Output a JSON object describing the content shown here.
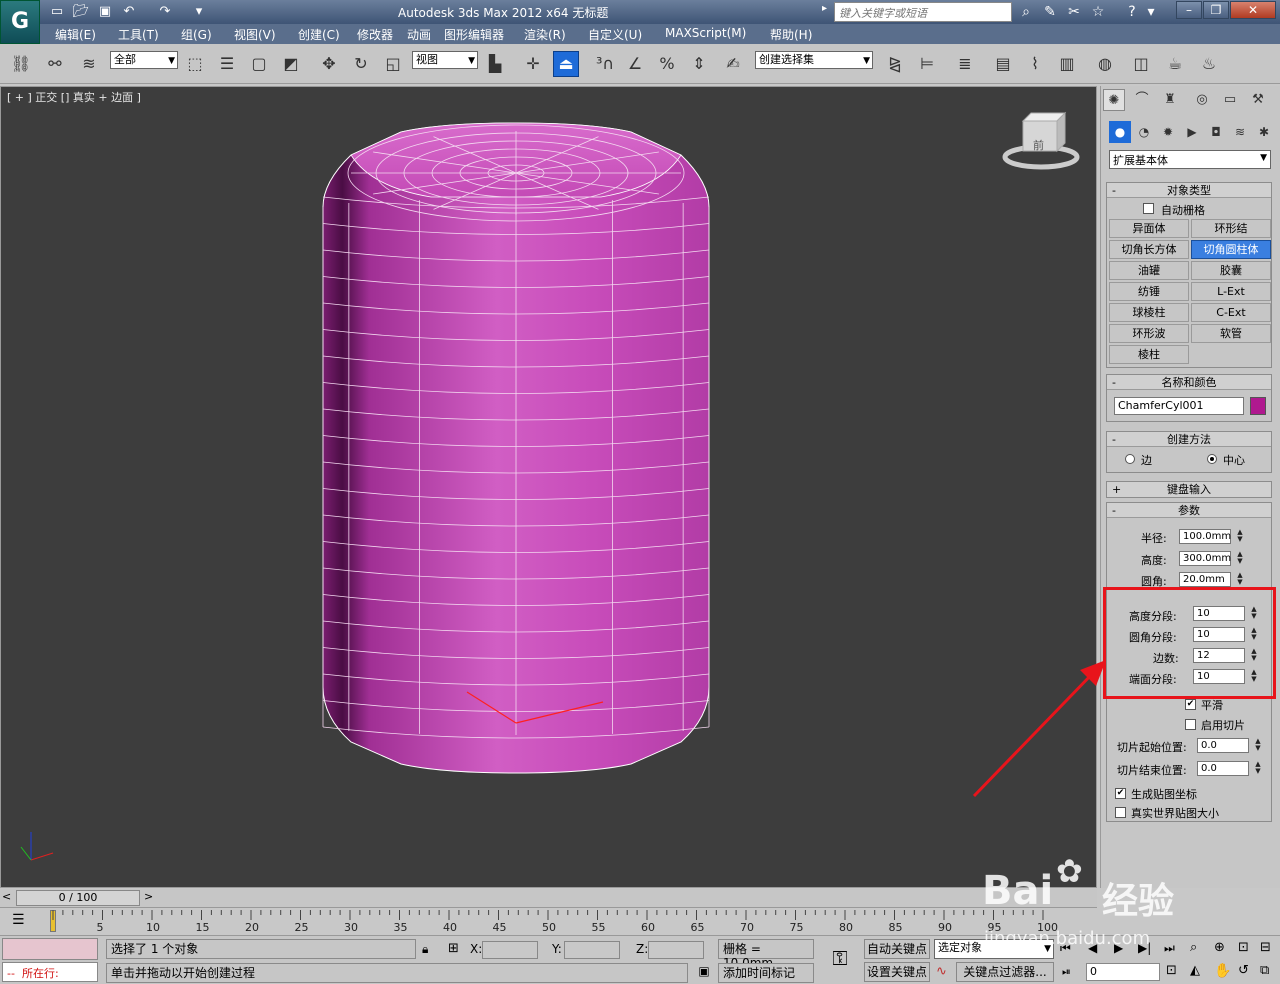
{
  "titlebar": {
    "title": "Autodesk 3ds Max  2012 x64     无标题",
    "search_placeholder": "键入关键字或短语",
    "app_logo": "G",
    "window_buttons": [
      "–",
      "❐",
      "✕"
    ]
  },
  "menu": [
    "编辑(E)",
    "工具(T)",
    "组(G)",
    "视图(V)",
    "创建(C)",
    "修改器",
    "动画",
    "图形编辑器",
    "渲染(R)",
    "自定义(U)",
    "MAXScript(M)",
    "帮助(H)"
  ],
  "toolbar": {
    "selection_filter": "全部",
    "ref_coord": "视图",
    "named_selection": "创建选择集"
  },
  "viewport": {
    "label": "[ + ] 正交 [] 真实 + 边面 ]",
    "viewcube_face": "前",
    "object_color": "#c23cb4"
  },
  "cmd_panel": {
    "category": "扩展基本体",
    "object_type": {
      "title": "对象类型",
      "autogrid_label": "自动栅格",
      "buttons": [
        "异面体",
        "环形结",
        "切角长方体",
        "切角圆柱体",
        "油罐",
        "胶囊",
        "纺锤",
        "L-Ext",
        "球棱柱",
        "C-Ext",
        "环形波",
        "软管",
        "棱柱"
      ],
      "selected": "切角圆柱体"
    },
    "name_color": {
      "title": "名称和颜色",
      "name": "ChamferCyl001",
      "swatch": "#b0198f"
    },
    "creation_method": {
      "title": "创建方法",
      "options": [
        "边",
        "中心"
      ],
      "selected": "中心"
    },
    "keyboard_entry": {
      "title": "键盘输入"
    },
    "parameters": {
      "title": "参数",
      "radius_label": "半径:",
      "radius": "100.0mm",
      "height_label": "高度:",
      "height": "300.0mm",
      "fillet_label": "圆角:",
      "fillet": "20.0mm",
      "height_segs_label": "高度分段:",
      "height_segs": "10",
      "fillet_segs_label": "圆角分段:",
      "fillet_segs": "10",
      "sides_label": "边数:",
      "sides": "12",
      "cap_segs_label": "端面分段:",
      "cap_segs": "10",
      "smooth_label": "平滑",
      "slice_on_label": "启用切片",
      "slice_from_label": "切片起始位置:",
      "slice_from": "0.0",
      "slice_to_label": "切片结束位置:",
      "slice_to": "0.0",
      "gen_uv_label": "生成贴图坐标",
      "real_world_label": "真实世界贴图大小"
    }
  },
  "timeline": {
    "frame_display": "0 / 100",
    "ticks": [
      5,
      10,
      15,
      20,
      25,
      30,
      35,
      40,
      45,
      50,
      55,
      60,
      65,
      70,
      75,
      80,
      85,
      90,
      95,
      100
    ]
  },
  "status": {
    "selection_msg": "选择了 1 个对象",
    "prompt_msg": "单击并拖动以开始创建过程",
    "running_label": "所在行:",
    "x_label": "X:",
    "y_label": "Y:",
    "z_label": "Z:",
    "grid": "栅格 = 10.0mm",
    "add_time_tag": "添加时间标记",
    "auto_key": "自动关键点",
    "set_key": "设置关键点",
    "selected_obj": "选定对象",
    "key_filters": "关键点过滤器...",
    "frame_value": "0"
  },
  "watermark": {
    "brand": "Bai",
    "brand2": "经验",
    "url": "jingyan.baidu.com"
  }
}
